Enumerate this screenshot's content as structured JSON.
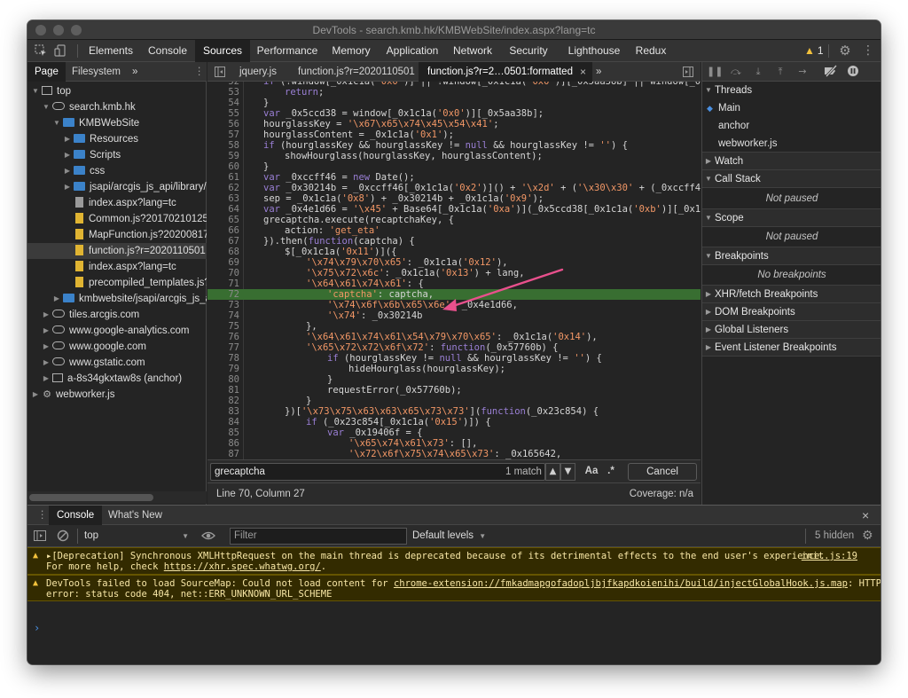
{
  "window": {
    "title": "DevTools - search.kmb.hk/KMBWebSite/index.aspx?lang=tc"
  },
  "main_tabs": [
    {
      "label": "Elements"
    },
    {
      "label": "Console"
    },
    {
      "label": "Sources",
      "active": true
    },
    {
      "label": "Performance"
    },
    {
      "label": "Memory"
    },
    {
      "label": "Application"
    },
    {
      "label": "Network"
    },
    {
      "label": "Security"
    },
    {
      "label": "Lighthouse"
    },
    {
      "label": "Redux"
    }
  ],
  "warnings_count": "1",
  "navigator": {
    "tabs": [
      {
        "label": "Page",
        "active": true
      },
      {
        "label": "Filesystem"
      }
    ],
    "more": "»",
    "tree": [
      {
        "label": "top",
        "icon": "frame-icon",
        "depth": 0,
        "twisty": "open"
      },
      {
        "label": "search.kmb.hk",
        "icon": "cloud-icon",
        "depth": 1,
        "twisty": "open"
      },
      {
        "label": "KMBWebSite",
        "icon": "folder-icon",
        "depth": 2,
        "twisty": "open"
      },
      {
        "label": "Resources",
        "icon": "folder-icon",
        "depth": 3,
        "twisty": "closed"
      },
      {
        "label": "Scripts",
        "icon": "folder-icon",
        "depth": 3,
        "twisty": "closed"
      },
      {
        "label": "css",
        "icon": "folder-icon",
        "depth": 3,
        "twisty": "closed"
      },
      {
        "label": "jsapi/arcgis_js_api/library/3.",
        "icon": "folder-icon",
        "depth": 3,
        "twisty": "closed"
      },
      {
        "label": "index.aspx?lang=tc",
        "icon": "file-gray-icon",
        "depth": 3,
        "twisty": ""
      },
      {
        "label": "Common.js?20170210125",
        "icon": "file-yellow-icon",
        "depth": 3,
        "twisty": ""
      },
      {
        "label": "MapFunction.js?20200817",
        "icon": "file-yellow-icon",
        "depth": 3,
        "twisty": ""
      },
      {
        "label": "function.js?r=2020110501",
        "icon": "file-yellow-icon",
        "depth": 3,
        "twisty": "",
        "selected": true
      },
      {
        "label": "index.aspx?lang=tc",
        "icon": "file-yellow-icon",
        "depth": 3,
        "twisty": ""
      },
      {
        "label": "precompiled_templates.js?2",
        "icon": "file-yellow-icon",
        "depth": 3,
        "twisty": ""
      },
      {
        "label": "kmbwebsite/jsapi/arcgis_js_ap",
        "icon": "folder-icon",
        "depth": 2,
        "twisty": "closed"
      },
      {
        "label": "tiles.arcgis.com",
        "icon": "cloud-icon",
        "depth": 1,
        "twisty": "closed"
      },
      {
        "label": "www.google-analytics.com",
        "icon": "cloud-icon",
        "depth": 1,
        "twisty": "closed"
      },
      {
        "label": "www.google.com",
        "icon": "cloud-icon",
        "depth": 1,
        "twisty": "closed"
      },
      {
        "label": "www.gstatic.com",
        "icon": "cloud-icon",
        "depth": 1,
        "twisty": "closed"
      },
      {
        "label": "a-8s34gkxtaw8s (anchor)",
        "icon": "frame-icon",
        "depth": 1,
        "twisty": "closed"
      },
      {
        "label": "webworker.js",
        "icon": "gear-icon",
        "depth": 0,
        "twisty": "closed"
      }
    ]
  },
  "editor": {
    "tabs": [
      {
        "label": "jquery.js"
      },
      {
        "label": "function.js?r=2020110501"
      },
      {
        "label": "function.js?r=2…0501:formatted",
        "active": true,
        "closable": true
      }
    ],
    "more": "»",
    "highlighted_line": 72,
    "lines": [
      {
        "n": "52",
        "indent": 0,
        "t": "if (!window[_0x1c1a('0x0')] || !window[_0x1c1a('0x0')][_0x5aa38b] || window[_0x1"
      },
      {
        "n": "53",
        "indent": 1,
        "t": "return;"
      },
      {
        "n": "54",
        "indent": 0,
        "t": "}"
      },
      {
        "n": "55",
        "indent": 0,
        "t": "var _0x5ccd38 = window[_0x1c1a('0x0')][_0x5aa38b];"
      },
      {
        "n": "56",
        "indent": 0,
        "t": "hourglassKey = '\\x67\\x65\\x74\\x45\\x54\\x41';"
      },
      {
        "n": "57",
        "indent": 0,
        "t": "hourglassContent = _0x1c1a('0x1');"
      },
      {
        "n": "58",
        "indent": 0,
        "t": "if (hourglassKey && hourglassKey != null && hourglassKey != '') {"
      },
      {
        "n": "59",
        "indent": 1,
        "t": "showHourglass(hourglassKey, hourglassContent);"
      },
      {
        "n": "60",
        "indent": 0,
        "t": "}"
      },
      {
        "n": "61",
        "indent": 0,
        "t": "var _0xccff46 = new Date();"
      },
      {
        "n": "62",
        "indent": 0,
        "t": "var _0x30214b = _0xccff46[_0x1c1a('0x2')]() + '\\x2d' + ('\\x30\\x30' + (_0xccff46["
      },
      {
        "n": "63",
        "indent": 0,
        "t": "sep = _0x1c1a('0x8') + _0x30214b + _0x1c1a('0x9');"
      },
      {
        "n": "64",
        "indent": 0,
        "t": "var _0x4e1d66 = '\\x45' + Base64[_0x1c1a('0xa')](_0x5ccd38[_0x1c1a('0xb')][_0x1c1"
      },
      {
        "n": "65",
        "indent": 0,
        "t": "grecaptcha.execute(recaptchaKey, {"
      },
      {
        "n": "66",
        "indent": 1,
        "t": "action: 'get_eta'"
      },
      {
        "n": "67",
        "indent": 0,
        "t": "}).then(function(captcha) {"
      },
      {
        "n": "68",
        "indent": 1,
        "t": "$[_0x1c1a('0x11')]({"
      },
      {
        "n": "69",
        "indent": 2,
        "t": "'\\x74\\x79\\x70\\x65': _0x1c1a('0x12'),"
      },
      {
        "n": "70",
        "indent": 2,
        "t": "'\\x75\\x72\\x6c': _0x1c1a('0x13') + lang,"
      },
      {
        "n": "71",
        "indent": 2,
        "t": "'\\x64\\x61\\x74\\x61': {"
      },
      {
        "n": "72",
        "indent": 3,
        "t": "'captcha': captcha,"
      },
      {
        "n": "73",
        "indent": 3,
        "t": "'\\x74\\x6f\\x6b\\x65\\x6e': _0x4e1d66,"
      },
      {
        "n": "74",
        "indent": 3,
        "t": "'\\x74': _0x30214b"
      },
      {
        "n": "75",
        "indent": 2,
        "t": "},"
      },
      {
        "n": "76",
        "indent": 2,
        "t": "'\\x64\\x61\\x74\\x61\\x54\\x79\\x70\\x65': _0x1c1a('0x14'),"
      },
      {
        "n": "77",
        "indent": 2,
        "t": "'\\x65\\x72\\x72\\x6f\\x72': function(_0x57760b) {"
      },
      {
        "n": "78",
        "indent": 3,
        "t": "if (hourglassKey != null && hourglassKey != '') {"
      },
      {
        "n": "79",
        "indent": 4,
        "t": "hideHourglass(hourglassKey);"
      },
      {
        "n": "80",
        "indent": 3,
        "t": "}"
      },
      {
        "n": "81",
        "indent": 3,
        "t": "requestError(_0x57760b);"
      },
      {
        "n": "82",
        "indent": 2,
        "t": "}"
      },
      {
        "n": "83",
        "indent": 1,
        "t": "})['\\x73\\x75\\x63\\x63\\x65\\x73\\x73'](function(_0x23c854) {"
      },
      {
        "n": "84",
        "indent": 2,
        "t": "if (_0x23c854[_0x1c1a('0x15')]) {"
      },
      {
        "n": "85",
        "indent": 3,
        "t": "var _0x19406f = {"
      },
      {
        "n": "86",
        "indent": 4,
        "t": "'\\x65\\x74\\x61\\x73': [],"
      },
      {
        "n": "87",
        "indent": 4,
        "t": "'\\x72\\x6f\\x75\\x74\\x65\\x73': _0x165642,"
      }
    ],
    "search": {
      "value": "grecaptcha",
      "match_count": "1 match",
      "case_label": "Aa",
      "regex_label": ".*",
      "cancel_label": "Cancel"
    },
    "status": {
      "position": "Line 70, Column 27",
      "coverage": "Coverage: n/a"
    }
  },
  "debugger": {
    "threads_label": "Threads",
    "threads": [
      {
        "label": "Main",
        "current": true
      },
      {
        "label": "anchor"
      },
      {
        "label": "webworker.js"
      }
    ],
    "watch_label": "Watch",
    "call_stack_label": "Call Stack",
    "call_stack_empty": "Not paused",
    "scope_label": "Scope",
    "scope_empty": "Not paused",
    "breakpoints_label": "Breakpoints",
    "breakpoints_empty": "No breakpoints",
    "xhr_label": "XHR/fetch Breakpoints",
    "dom_label": "DOM Breakpoints",
    "global_label": "Global Listeners",
    "event_label": "Event Listener Breakpoints"
  },
  "drawer": {
    "tabs": [
      {
        "label": "Console",
        "active": true
      },
      {
        "label": "What's New"
      }
    ],
    "context": "top",
    "filter_placeholder": "Filter",
    "levels": "Default levels",
    "hidden": "5 hidden",
    "messages": [
      {
        "line1": "▸[Deprecation] Synchronous XMLHttpRequest on the main thread is deprecated because of its detrimental effects to the end user's experience.",
        "line2_prefix": "For more help, check ",
        "link": "https://xhr.spec.whatwg.org/",
        "line2_suffix": ".",
        "source": "init.js:19"
      },
      {
        "line1_prefix": "DevTools failed to load SourceMap: Could not load content for ",
        "link": "chrome-extension://fmkadmapgofadopljbjfkapdkoienihi/build/injectGlobalHook.js.map",
        "line1_suffix": ": HTTP",
        "line2": "error: status code 404, net::ERR_UNKNOWN_URL_SCHEME"
      }
    ],
    "prompt": "›"
  },
  "colors": {
    "accent": "#4a90e2",
    "highlight_line": "#386e31",
    "arrow": "#e8508c",
    "warning": "#f2c13c"
  }
}
